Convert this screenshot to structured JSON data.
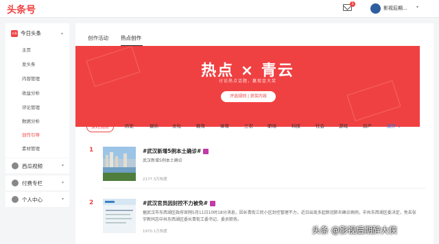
{
  "brand": {
    "logo": "头条号"
  },
  "header": {
    "user_name": "影视后期...",
    "mail_badge": "1"
  },
  "sidebar": {
    "head": "今日头条",
    "head_icon_text": "头条",
    "items": [
      {
        "label": "主页",
        "active": false
      },
      {
        "label": "发头条",
        "active": false
      },
      {
        "label": "内容管理",
        "active": false
      },
      {
        "label": "收益分析",
        "active": false
      },
      {
        "label": "评论管理",
        "active": false
      },
      {
        "label": "数据分析",
        "active": false
      },
      {
        "label": "创作引导",
        "active": true
      },
      {
        "label": "素材管理",
        "active": false
      }
    ],
    "sections": [
      "西瓜视频",
      "付费专栏",
      "个人中心"
    ]
  },
  "tabs": [
    {
      "label": "创作活动"
    },
    {
      "label": "热点创作"
    }
  ],
  "banner": {
    "title": "热点 × 青云",
    "subtitle": "讨论热点话题，赢现金大奖",
    "button": "评选规则 | 获奖内容",
    "color": "#f04142"
  },
  "categories": [
    {
      "label": "实时热点",
      "active": true
    },
    {
      "label": "历史"
    },
    {
      "label": "娱乐"
    },
    {
      "label": "文化"
    },
    {
      "label": "教育"
    },
    {
      "label": "体育"
    },
    {
      "label": "三农"
    },
    {
      "label": "职场"
    },
    {
      "label": "科技"
    },
    {
      "label": "社会"
    },
    {
      "label": "游戏"
    },
    {
      "label": "房产"
    }
  ],
  "more_label": "展开 ⌄",
  "items": [
    {
      "rank": "1",
      "title": "#武汉新增5例本土确诊#",
      "desc": "武汉新增5例本土确诊",
      "heat": "2177.3万热度"
    },
    {
      "rank": "2",
      "title": "#武汉官员因封控不力被免#",
      "desc": "据武汉市东西湖区政府官网5月11日10时18分消息，因长青街三民小区封控管理不力，近日出现多起新冠肺炎确诊病例，中共东西湖区委决定，免去张宇新同志中共东西湖区委长青街工委书记、委员职务。",
      "heat": "1970.1万热度"
    }
  ],
  "watermark": "头条 @影视后期醉大侠"
}
